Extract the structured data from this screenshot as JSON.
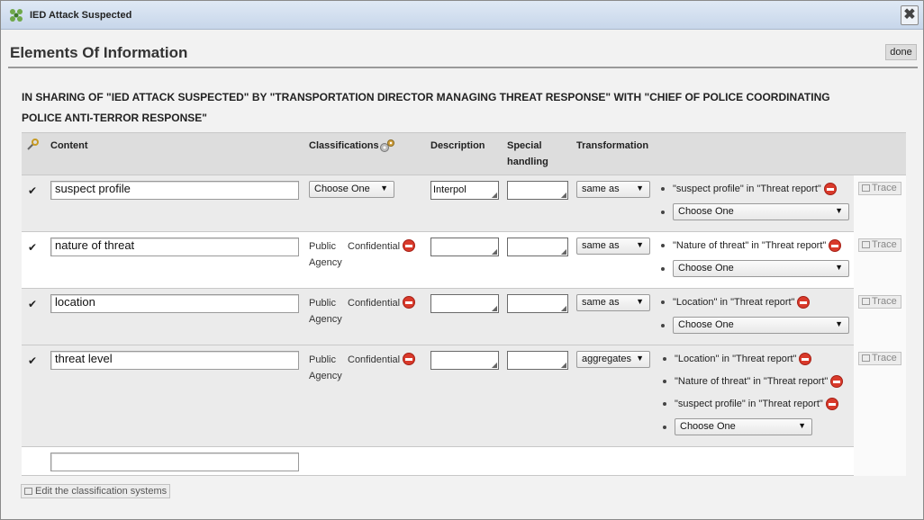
{
  "window": {
    "title": "IED Attack Suspected"
  },
  "panel": {
    "title": "Elements Of Information",
    "done_label": "done",
    "sharing_heading": "In sharing of \"IED Attack Suspected\" by \"Transportation director managing threat response\" with \"Chief of police coordinating police anti-terror response\""
  },
  "columns": {
    "content": "Content",
    "classifications": "Classifications",
    "description": "Description",
    "special_handling_1": "Special",
    "special_handling_2": "handling",
    "transformation": "Transformation"
  },
  "rows": [
    {
      "checked": "✔",
      "content": "suspect profile",
      "classification_select": "Choose One",
      "description": "Interpol",
      "transformation": "same as",
      "sources": [
        "\"suspect profile\" in \"Threat report\""
      ],
      "source_select": "Choose One",
      "trace": "Trace"
    },
    {
      "checked": "✔",
      "content": "nature of threat",
      "classification_system": "Public Agency",
      "classification_system_1": "Public",
      "classification_system_2": "Agency",
      "classification_level": "Confidential",
      "description": "",
      "transformation": "same as",
      "sources": [
        "\"Nature of threat\" in \"Threat report\""
      ],
      "source_select": "Choose One",
      "trace": "Trace"
    },
    {
      "checked": "✔",
      "content": "location",
      "classification_system_1": "Public",
      "classification_system_2": "Agency",
      "classification_level": "Confidential",
      "description": "",
      "transformation": "same as",
      "sources": [
        "\"Location\" in \"Threat report\""
      ],
      "source_select": "Choose One",
      "trace": "Trace"
    },
    {
      "checked": "✔",
      "content": "threat level",
      "classification_system_1": "Public",
      "classification_system_2": "Agency",
      "classification_level": "Confidential",
      "description": "",
      "transformation": "aggregates",
      "sources": [
        "\"Location\" in \"Threat report\"",
        "\"Nature of threat\" in \"Threat report\"",
        "\"suspect profile\" in \"Threat report\""
      ],
      "source_select": "Choose One",
      "trace": "Trace"
    }
  ],
  "new_row": {
    "content": ""
  },
  "footer": {
    "edit_classification_label": "Edit the classification systems"
  }
}
